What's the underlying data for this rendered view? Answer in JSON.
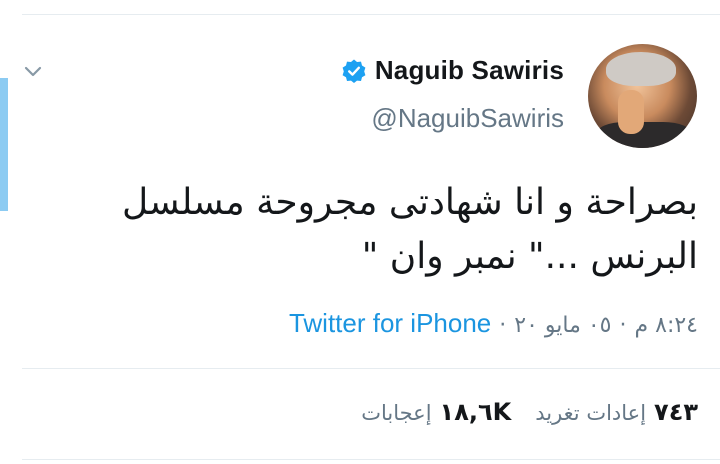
{
  "author": {
    "name": "Naguib Sawiris",
    "handle": "@NaguibSawiris",
    "verified": true
  },
  "tweet": {
    "line1": "بصراحة و انا شهادتى مجروحة  مسلسل",
    "line2": "البرنس ...\" نمبر وان \""
  },
  "meta": {
    "time": "٨:٢٤ م",
    "separator1": "·",
    "date": "٠٥ مايو ٢٠",
    "separator2": "·",
    "source": "Twitter for iPhone"
  },
  "stats": {
    "retweets_count": "٧٤٣",
    "retweets_label": "إعادات تغريد",
    "likes_count": "١٨,٦K",
    "likes_label": "إعجابات"
  },
  "colors": {
    "link": "#1b95e0",
    "muted": "#657786",
    "verified": "#1da1f2",
    "accent_bar": "#8ccbf2"
  },
  "icons": {
    "caret": "chevron-down-icon",
    "verified": "verified-badge-icon"
  }
}
